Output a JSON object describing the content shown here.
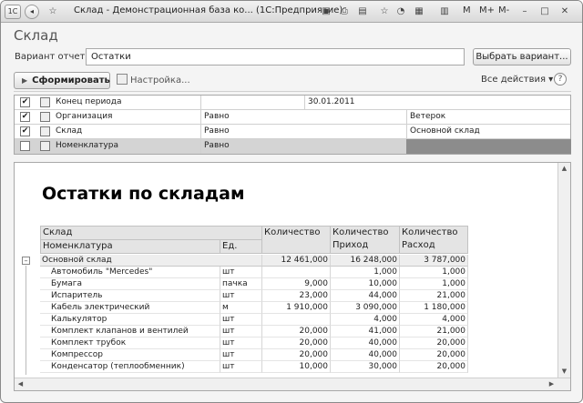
{
  "window": {
    "title": "Склад - Демонстрационная база ко... (1С:Предприятие)",
    "toolbar_right": [
      "M",
      "M+",
      "M-"
    ]
  },
  "header": {
    "title": "Склад",
    "variant_label": "Вариант отчета:",
    "variant_value": "Остатки",
    "choose_variant": "Выбрать вариант...",
    "generate": "Сформировать",
    "settings": "Настройка...",
    "all_actions": "Все действия ▾",
    "help": "?"
  },
  "filters": [
    {
      "checked": true,
      "name": "Конец периода",
      "condition": "",
      "value": "30.01.2011"
    },
    {
      "checked": true,
      "name": "Организация",
      "condition": "Равно",
      "value": "Ветерок"
    },
    {
      "checked": true,
      "name": "Склад",
      "condition": "Равно",
      "value": "Основной склад"
    },
    {
      "checked": false,
      "name": "Номенклатура",
      "condition": "Равно",
      "value": ""
    }
  ],
  "report": {
    "title": "Остатки по складам",
    "headers": {
      "col1_top": "Склад",
      "col1_bottom": "Номенклатура",
      "col2": "Ед.",
      "col3": "Количество",
      "col4_top": "Количество",
      "col4_bottom": "Приход",
      "col5_top": "Количество",
      "col5_bottom": "Расход"
    },
    "group": {
      "name": "Основной склад",
      "qty": "12 461,000",
      "in": "16 248,000",
      "out": "3 787,000"
    },
    "rows": [
      {
        "name": "Автомобиль \"Mercedes\"",
        "unit": "шт",
        "qty": "",
        "in": "1,000",
        "out": "1,000"
      },
      {
        "name": "Бумага",
        "unit": "пачка",
        "qty": "9,000",
        "in": "10,000",
        "out": "1,000"
      },
      {
        "name": "Испаритель",
        "unit": "шт",
        "qty": "23,000",
        "in": "44,000",
        "out": "21,000"
      },
      {
        "name": "Кабель электрический",
        "unit": "м",
        "qty": "1 910,000",
        "in": "3 090,000",
        "out": "1 180,000"
      },
      {
        "name": "Калькулятор",
        "unit": "шт",
        "qty": "",
        "in": "4,000",
        "out": "4,000"
      },
      {
        "name": "Комплект клапанов и вентилей",
        "unit": "шт",
        "qty": "20,000",
        "in": "41,000",
        "out": "21,000"
      },
      {
        "name": "Комплект трубок",
        "unit": "шт",
        "qty": "20,000",
        "in": "40,000",
        "out": "20,000"
      },
      {
        "name": "Компрессор",
        "unit": "шт",
        "qty": "20,000",
        "in": "40,000",
        "out": "20,000"
      },
      {
        "name": "Конденсатор (теплообменник)",
        "unit": "шт",
        "qty": "10,000",
        "in": "30,000",
        "out": "20,000"
      }
    ]
  }
}
